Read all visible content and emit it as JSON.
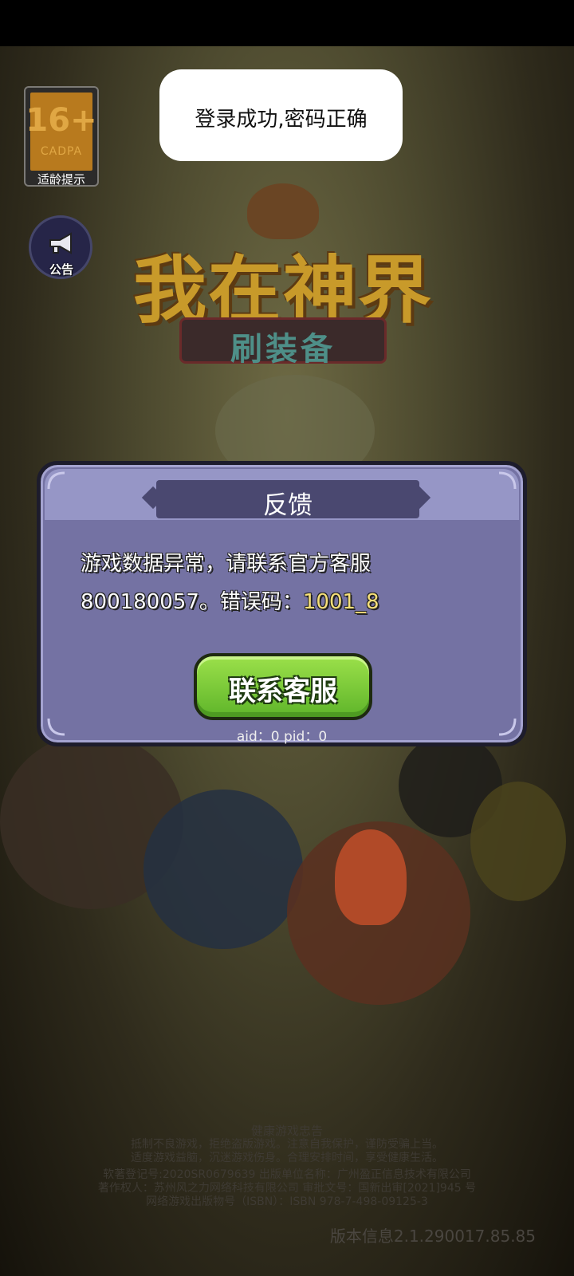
{
  "toast": {
    "message": "登录成功,密码正确"
  },
  "age_rating": {
    "number": "16+",
    "org": "CADPA",
    "hint": "适龄提示"
  },
  "notice_button": {
    "label": "公告",
    "icon": "megaphone-icon"
  },
  "logo": {
    "title": "我在神界",
    "subtitle": "刷装备"
  },
  "dialog": {
    "title": "反馈",
    "message_line1": "游戏数据异常，请联系官方客服",
    "message_line2_prefix": "800180057。错误码：",
    "error_code": "1001_8",
    "contact_button": "联系客服",
    "ids": "aid：0  pid：0",
    "accent_color": "#7472a3",
    "button_color": "#7bc93a",
    "error_code_color": "#f6e07a"
  },
  "footer": {
    "advice_title": "健康游戏忠告",
    "advice_line1": "抵制不良游戏，拒绝盗版游戏。注意自我保护，谨防受骗上当。",
    "advice_line2": "适度游戏益脑，沉迷游戏伤身。合理安排时间，享受健康生活。",
    "copyright_line1": "软著登记号:2020SR0679639 出版单位名称：广州盈正信息技术有限公司",
    "copyright_line2": "著作权人：苏州风之力网络科技有限公司 审批文号：国新出审[2021]945 号",
    "copyright_line3": "网络游戏出版物号（ISBN）：ISBN 978-7-498-09125-3",
    "version": "版本信息2.1.290017.85.85"
  }
}
